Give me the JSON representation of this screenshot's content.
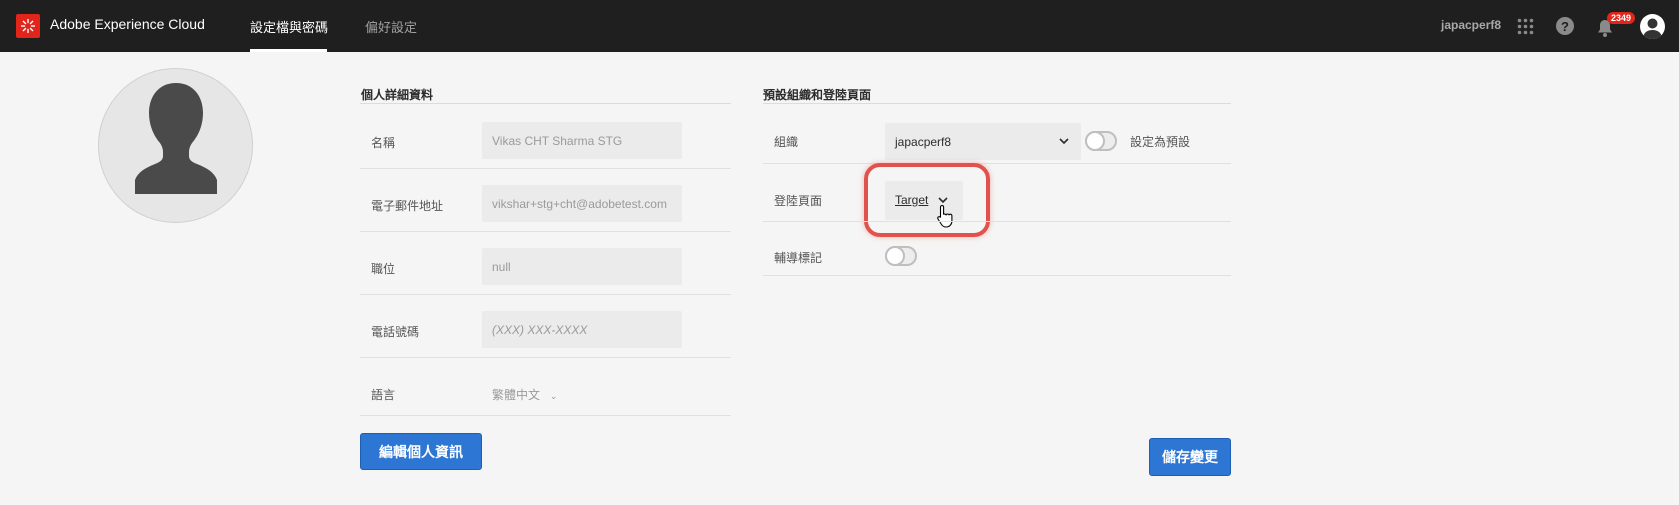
{
  "header": {
    "brand": "Adobe Experience Cloud",
    "tabs": [
      {
        "label": "設定檔與密碼",
        "active": true
      },
      {
        "label": "偏好設定",
        "active": false
      }
    ],
    "username": "japacperf8",
    "notification_count": "2349",
    "help_label": "?"
  },
  "profile": {
    "section_title": "個人詳細資料",
    "rows": [
      {
        "label": "名稱",
        "value": "Vikas CHT Sharma STG"
      },
      {
        "label": "電子郵件地址",
        "value": "vikshar+stg+cht@adobetest.com"
      },
      {
        "label": "職位",
        "value": "null"
      },
      {
        "label": "電話號碼",
        "placeholder": "(XXX) XXX-XXXX"
      }
    ],
    "language_label": "語言",
    "language_value": "繁體中文",
    "edit_button": "編輯個人資訊"
  },
  "defaults": {
    "section_title": "預設組織和登陸頁面",
    "org_label": "組織",
    "org_value": "japacperf8",
    "set_default_label": "設定為預設",
    "landing_label": "登陸頁面",
    "landing_value": "Target",
    "coachmark_label": "輔導標記",
    "save_button": "儲存變更"
  },
  "colors": {
    "topbar": "#1f1f1f",
    "accent": "#2d76d4",
    "brand_red": "#e1251b",
    "highlight": "#e0524b"
  },
  "icons": [
    "adobe-logo-icon",
    "apps-grid-icon",
    "help-icon",
    "bell-icon",
    "user-avatar-icon",
    "chevron-down-icon",
    "pointer-cursor-icon"
  ]
}
